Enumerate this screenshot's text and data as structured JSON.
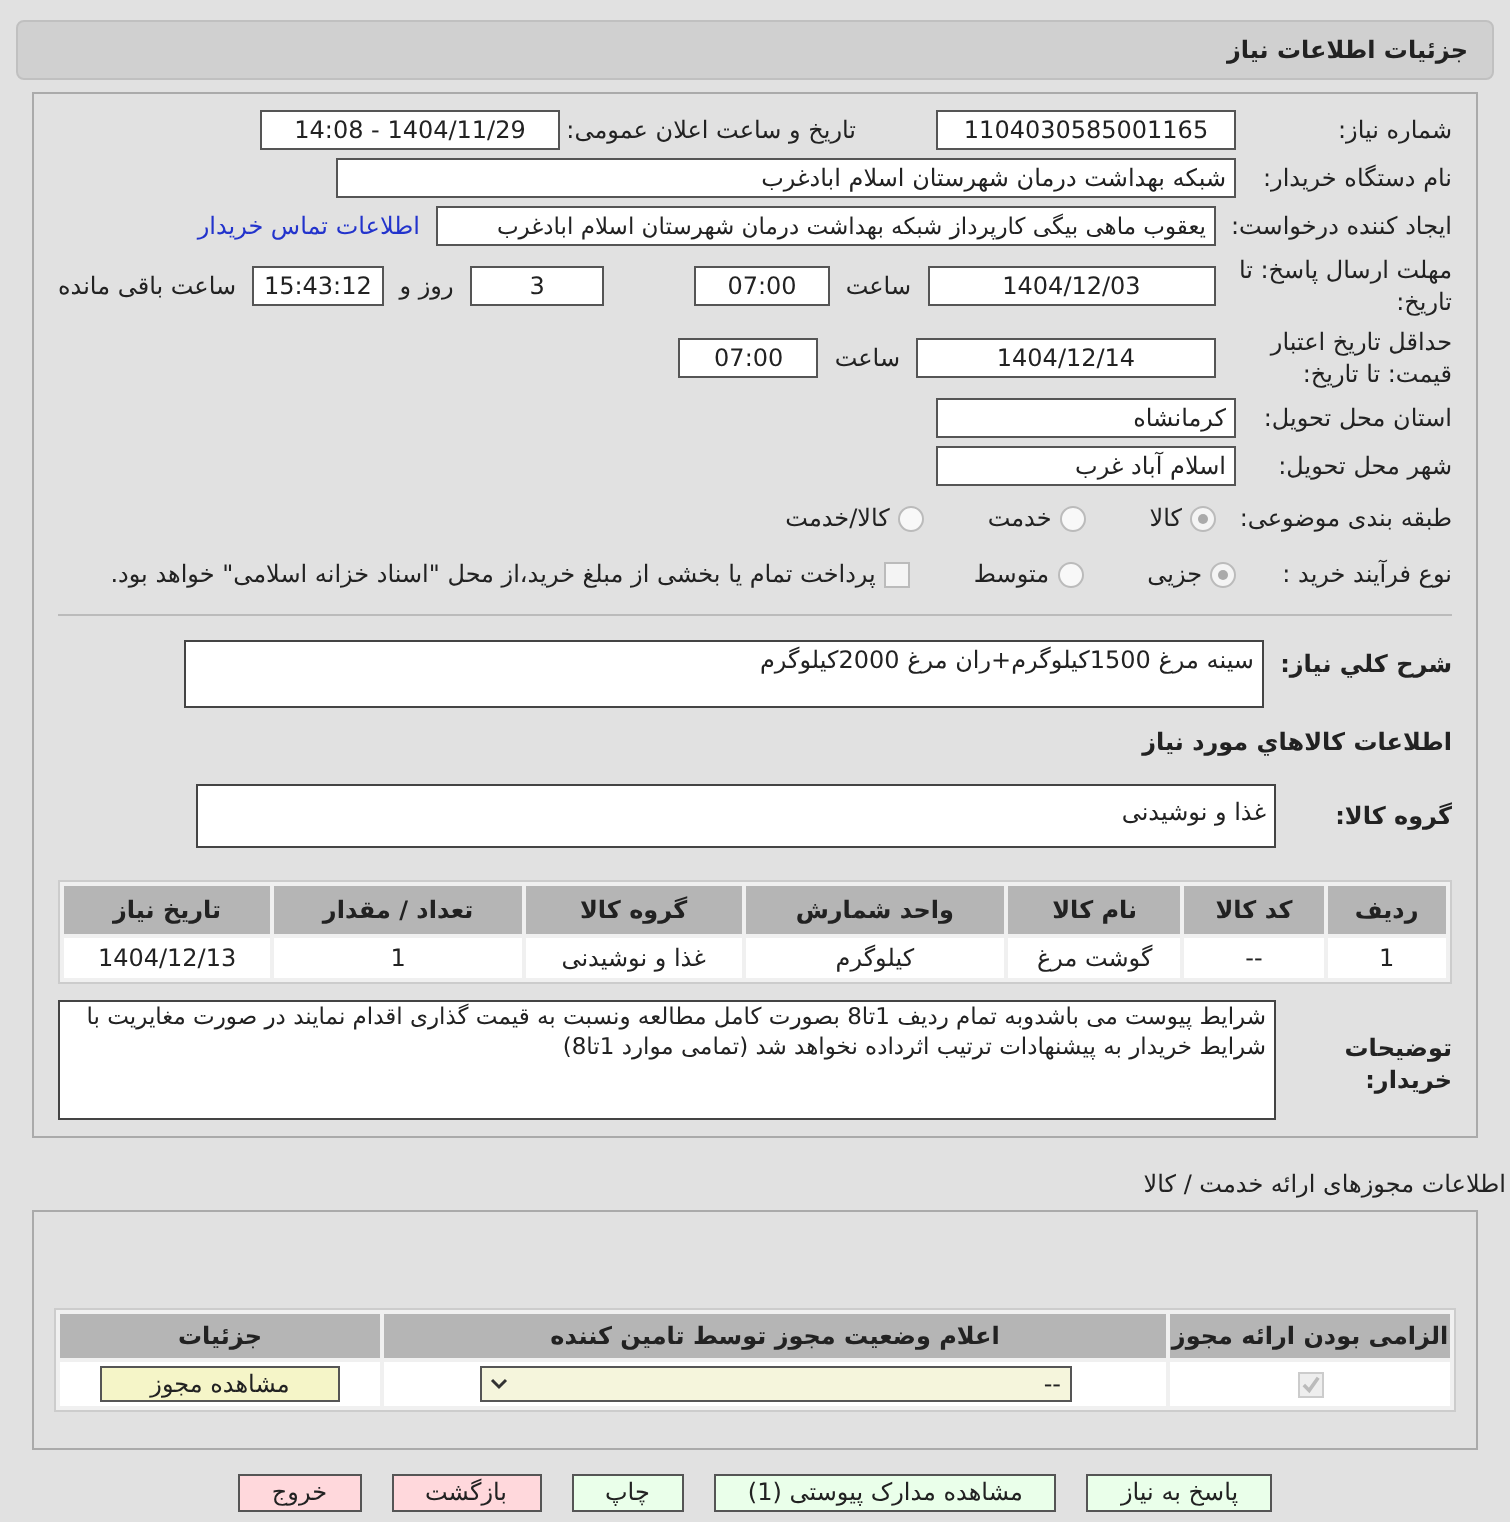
{
  "header": {
    "title": "جزئیات اطلاعات نیاز"
  },
  "fields": {
    "need_number": {
      "label": "شماره نیاز:",
      "value": "1104030585001165"
    },
    "announce": {
      "label": "تاریخ و ساعت اعلان عمومی:",
      "value": "1404/11/29 - 14:08"
    },
    "buyer": {
      "label": "نام دستگاه خریدار:",
      "value": "شبکه بهداشت درمان شهرستان اسلام ابادغرب"
    },
    "creator": {
      "label": "ایجاد کننده درخواست:",
      "value": "یعقوب ماهی بیگی کارپرداز شبکه بهداشت درمان شهرستان اسلام ابادغرب",
      "link": "اطلاعات تماس خریدار"
    },
    "deadline": {
      "label": "مهلت ارسال پاسخ: تا تاریخ:",
      "date": "1404/12/03",
      "time_label": "ساعت",
      "time": "07:00",
      "days": "3",
      "days_label": "روز و",
      "remaining": "15:43:12",
      "remaining_label": "ساعت باقی مانده"
    },
    "validity": {
      "label": "حداقل تاریخ اعتبار قیمت: تا تاریخ:",
      "date": "1404/12/14",
      "time_label": "ساعت",
      "time": "07:00"
    },
    "province": {
      "label": "استان محل تحویل:",
      "value": "کرمانشاه"
    },
    "city": {
      "label": "شهر محل تحویل:",
      "value": "اسلام آباد غرب"
    },
    "category": {
      "label": "طبقه بندی موضوعی:",
      "options": [
        {
          "label": "کالا",
          "selected": true
        },
        {
          "label": "خدمت",
          "selected": false
        },
        {
          "label": "کالا/خدمت",
          "selected": false
        }
      ]
    },
    "process": {
      "label": "نوع فرآیند خرید :",
      "options": [
        {
          "label": "جزیی",
          "selected": true
        },
        {
          "label": "متوسط",
          "selected": false
        }
      ],
      "payment": {
        "checked": false,
        "label": "پرداخت تمام یا بخشی از مبلغ خرید،از محل \"اسناد خزانه اسلامی\" خواهد بود."
      }
    },
    "summary": {
      "label": "شرح کلي نياز:",
      "value": "سینه مرغ 1500کیلوگرم+ران مرغ 2000کیلوگرم"
    }
  },
  "goods_title": "اطلاعات کالاهاي مورد نياز",
  "goods_group": {
    "label": "گروه کالا:",
    "value": "غذا و نوشیدنی"
  },
  "table": {
    "columns": [
      "ردیف",
      "کد کالا",
      "نام کالا",
      "واحد شمارش",
      "گروه کالا",
      "تعداد / مقدار",
      "تاریخ نیاز"
    ],
    "rows": [
      [
        "1",
        "--",
        "گوشت مرغ",
        "کیلوگرم",
        "غذا و نوشیدنی",
        "1",
        "1404/12/13"
      ]
    ]
  },
  "buyer_notes": {
    "label": "توضیحات خریدار:",
    "value": "شرایط پیوست می باشدوبه تمام ردیف 1تا8 بصورت کامل مطالعه ونسبت به قیمت گذاری اقدام نمایند در صورت مغایریت با شرایط خریدار به پیشنهادات ترتیب اثرداده نخواهد شد (تمامی موارد 1تا8)"
  },
  "licenses": {
    "title": "اطلاعات مجوزهای ارائه خدمت / کالا",
    "columns": [
      "الزامی بودن ارائه مجوز",
      "اعلام وضعیت مجوز توسط تامین کننده",
      "جزئیات"
    ],
    "rows": [
      {
        "required": true,
        "status": "--",
        "action": "مشاهده مجوز"
      }
    ]
  },
  "buttons": [
    {
      "label": "پاسخ به نیاز",
      "kind": "green"
    },
    {
      "label": "مشاهده مدارک پیوستی (1)",
      "kind": "green"
    },
    {
      "label": "چاپ",
      "kind": "green"
    },
    {
      "label": "بازگشت",
      "kind": "red"
    },
    {
      "label": "خروج",
      "kind": "red"
    }
  ]
}
